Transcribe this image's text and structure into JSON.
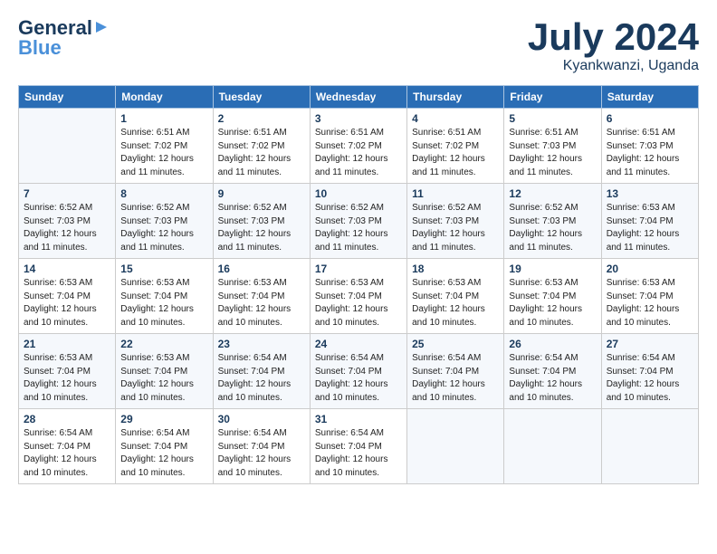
{
  "logo": {
    "line1": "General",
    "line2": "Blue"
  },
  "title": "July 2024",
  "subtitle": "Kyankwanzi, Uganda",
  "weekdays": [
    "Sunday",
    "Monday",
    "Tuesday",
    "Wednesday",
    "Thursday",
    "Friday",
    "Saturday"
  ],
  "weeks": [
    [
      {
        "num": "",
        "info": ""
      },
      {
        "num": "1",
        "info": "Sunrise: 6:51 AM\nSunset: 7:02 PM\nDaylight: 12 hours\nand 11 minutes."
      },
      {
        "num": "2",
        "info": "Sunrise: 6:51 AM\nSunset: 7:02 PM\nDaylight: 12 hours\nand 11 minutes."
      },
      {
        "num": "3",
        "info": "Sunrise: 6:51 AM\nSunset: 7:02 PM\nDaylight: 12 hours\nand 11 minutes."
      },
      {
        "num": "4",
        "info": "Sunrise: 6:51 AM\nSunset: 7:02 PM\nDaylight: 12 hours\nand 11 minutes."
      },
      {
        "num": "5",
        "info": "Sunrise: 6:51 AM\nSunset: 7:03 PM\nDaylight: 12 hours\nand 11 minutes."
      },
      {
        "num": "6",
        "info": "Sunrise: 6:51 AM\nSunset: 7:03 PM\nDaylight: 12 hours\nand 11 minutes."
      }
    ],
    [
      {
        "num": "7",
        "info": "Sunrise: 6:52 AM\nSunset: 7:03 PM\nDaylight: 12 hours\nand 11 minutes."
      },
      {
        "num": "8",
        "info": "Sunrise: 6:52 AM\nSunset: 7:03 PM\nDaylight: 12 hours\nand 11 minutes."
      },
      {
        "num": "9",
        "info": "Sunrise: 6:52 AM\nSunset: 7:03 PM\nDaylight: 12 hours\nand 11 minutes."
      },
      {
        "num": "10",
        "info": "Sunrise: 6:52 AM\nSunset: 7:03 PM\nDaylight: 12 hours\nand 11 minutes."
      },
      {
        "num": "11",
        "info": "Sunrise: 6:52 AM\nSunset: 7:03 PM\nDaylight: 12 hours\nand 11 minutes."
      },
      {
        "num": "12",
        "info": "Sunrise: 6:52 AM\nSunset: 7:03 PM\nDaylight: 12 hours\nand 11 minutes."
      },
      {
        "num": "13",
        "info": "Sunrise: 6:53 AM\nSunset: 7:04 PM\nDaylight: 12 hours\nand 11 minutes."
      }
    ],
    [
      {
        "num": "14",
        "info": "Sunrise: 6:53 AM\nSunset: 7:04 PM\nDaylight: 12 hours\nand 10 minutes."
      },
      {
        "num": "15",
        "info": "Sunrise: 6:53 AM\nSunset: 7:04 PM\nDaylight: 12 hours\nand 10 minutes."
      },
      {
        "num": "16",
        "info": "Sunrise: 6:53 AM\nSunset: 7:04 PM\nDaylight: 12 hours\nand 10 minutes."
      },
      {
        "num": "17",
        "info": "Sunrise: 6:53 AM\nSunset: 7:04 PM\nDaylight: 12 hours\nand 10 minutes."
      },
      {
        "num": "18",
        "info": "Sunrise: 6:53 AM\nSunset: 7:04 PM\nDaylight: 12 hours\nand 10 minutes."
      },
      {
        "num": "19",
        "info": "Sunrise: 6:53 AM\nSunset: 7:04 PM\nDaylight: 12 hours\nand 10 minutes."
      },
      {
        "num": "20",
        "info": "Sunrise: 6:53 AM\nSunset: 7:04 PM\nDaylight: 12 hours\nand 10 minutes."
      }
    ],
    [
      {
        "num": "21",
        "info": "Sunrise: 6:53 AM\nSunset: 7:04 PM\nDaylight: 12 hours\nand 10 minutes."
      },
      {
        "num": "22",
        "info": "Sunrise: 6:53 AM\nSunset: 7:04 PM\nDaylight: 12 hours\nand 10 minutes."
      },
      {
        "num": "23",
        "info": "Sunrise: 6:54 AM\nSunset: 7:04 PM\nDaylight: 12 hours\nand 10 minutes."
      },
      {
        "num": "24",
        "info": "Sunrise: 6:54 AM\nSunset: 7:04 PM\nDaylight: 12 hours\nand 10 minutes."
      },
      {
        "num": "25",
        "info": "Sunrise: 6:54 AM\nSunset: 7:04 PM\nDaylight: 12 hours\nand 10 minutes."
      },
      {
        "num": "26",
        "info": "Sunrise: 6:54 AM\nSunset: 7:04 PM\nDaylight: 12 hours\nand 10 minutes."
      },
      {
        "num": "27",
        "info": "Sunrise: 6:54 AM\nSunset: 7:04 PM\nDaylight: 12 hours\nand 10 minutes."
      }
    ],
    [
      {
        "num": "28",
        "info": "Sunrise: 6:54 AM\nSunset: 7:04 PM\nDaylight: 12 hours\nand 10 minutes."
      },
      {
        "num": "29",
        "info": "Sunrise: 6:54 AM\nSunset: 7:04 PM\nDaylight: 12 hours\nand 10 minutes."
      },
      {
        "num": "30",
        "info": "Sunrise: 6:54 AM\nSunset: 7:04 PM\nDaylight: 12 hours\nand 10 minutes."
      },
      {
        "num": "31",
        "info": "Sunrise: 6:54 AM\nSunset: 7:04 PM\nDaylight: 12 hours\nand 10 minutes."
      },
      {
        "num": "",
        "info": ""
      },
      {
        "num": "",
        "info": ""
      },
      {
        "num": "",
        "info": ""
      }
    ]
  ]
}
